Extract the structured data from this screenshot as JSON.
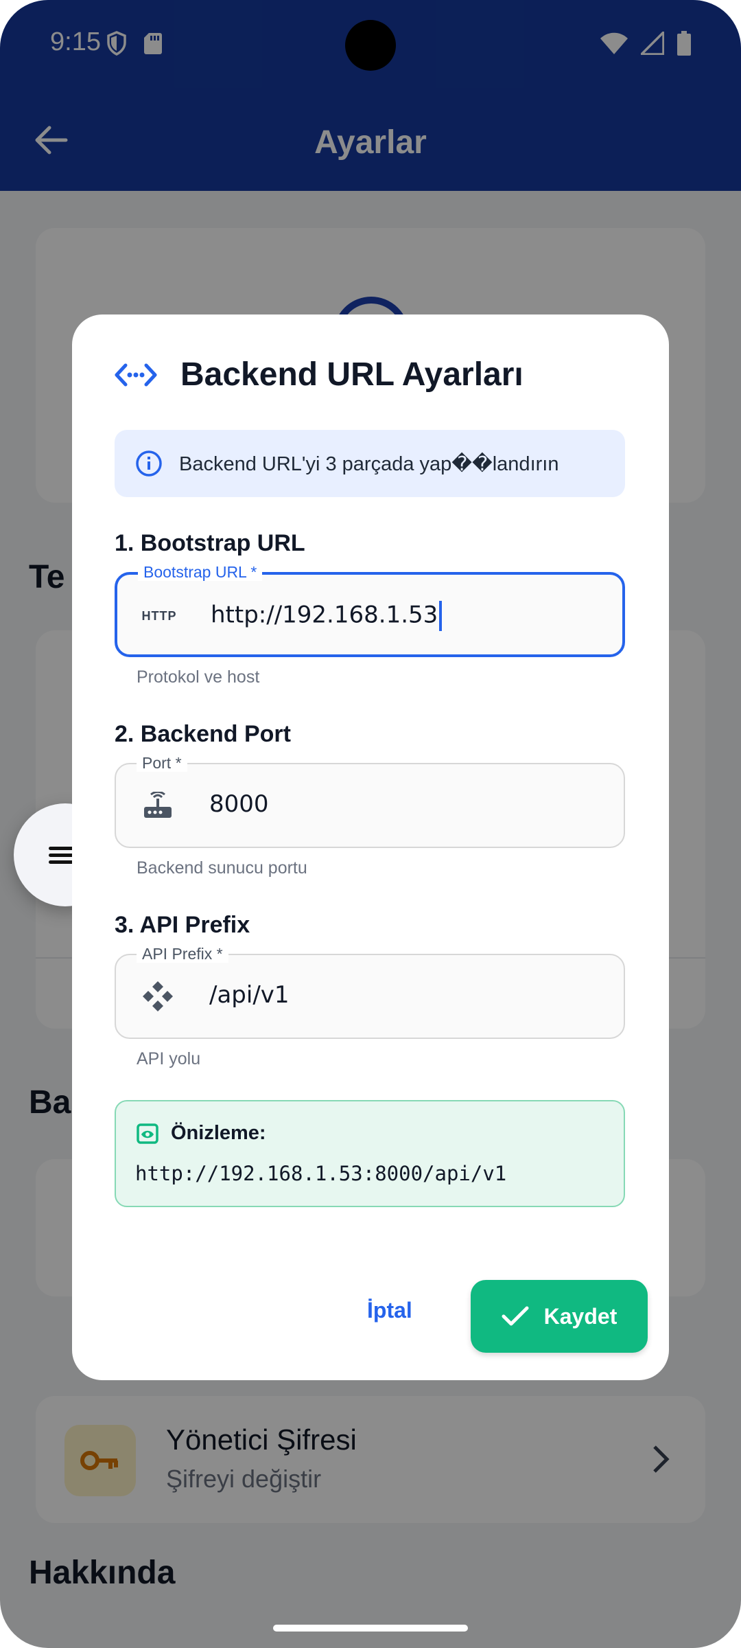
{
  "status": {
    "time": "9:15"
  },
  "appbar": {
    "title": "Ayarlar"
  },
  "background": {
    "section_partial_1": "Te",
    "section_partial_2": "Ba",
    "admin_title": "Yönetici Şifresi",
    "admin_subtitle": "Şifreyi değiştir",
    "about_heading": "Hakkında"
  },
  "dialog": {
    "title": "Backend URL Ayarları",
    "info_banner": "Backend URL'yi 3 parçada yap��landırın",
    "bootstrap": {
      "step_label": "1. Bootstrap URL",
      "field_label": "Bootstrap URL *",
      "badge": "HTTP",
      "value": "http://192.168.1.53",
      "helper": "Protokol ve host"
    },
    "port": {
      "step_label": "2. Backend Port",
      "field_label": "Port *",
      "value": "8000",
      "helper": "Backend sunucu portu"
    },
    "prefix": {
      "step_label": "3. API Prefix",
      "field_label": "API Prefix *",
      "value": "/api/v1",
      "helper": "API yolu"
    },
    "preview": {
      "title": "Önizleme:",
      "url": "http://192.168.1.53:8000/api/v1"
    },
    "cancel_label": "İptal",
    "save_label": "Kaydet"
  },
  "colors": {
    "primary": "#163a9e",
    "accent_blue": "#2563eb",
    "success": "#10b981"
  }
}
